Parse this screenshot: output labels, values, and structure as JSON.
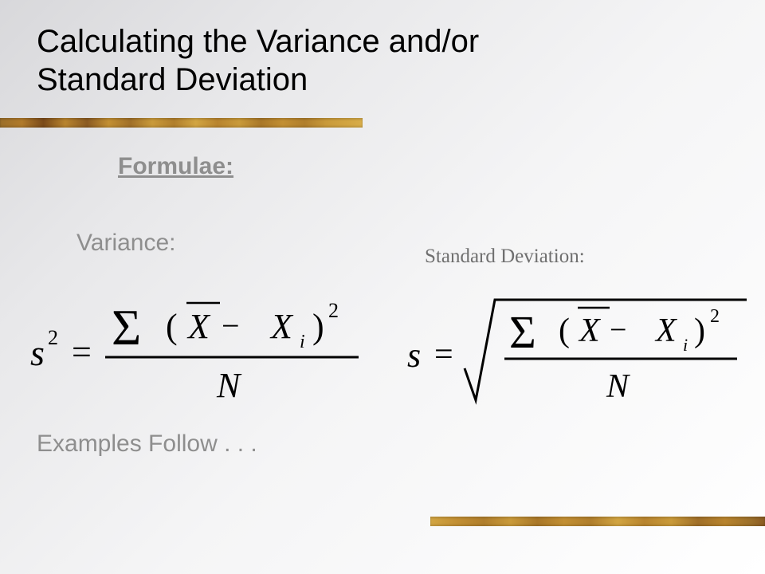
{
  "title_line1": "Calculating the Variance and/or",
  "title_line2": "Standard Deviation",
  "formulae_heading": "Formulae:",
  "variance_label": "Variance:",
  "stddev_label": "Standard Deviation:",
  "examples_label": "Examples Follow . . .",
  "formulas": {
    "variance": {
      "lhs_base": "s",
      "lhs_exp": "2",
      "numerator_sigma": "Σ",
      "numerator_term_prefix": "(",
      "numerator_xbar": "X",
      "numerator_minus": " − ",
      "numerator_xi_base": "X",
      "numerator_xi_sub": "i",
      "numerator_term_suffix": ")",
      "numerator_exp": "2",
      "denominator": "N"
    },
    "stddev": {
      "lhs_base": "s",
      "numerator_sigma": "Σ",
      "numerator_term_prefix": "(",
      "numerator_xbar": "X",
      "numerator_minus": " − ",
      "numerator_xi_base": "X",
      "numerator_xi_sub": "i",
      "numerator_term_suffix": ")",
      "numerator_exp": "2",
      "denominator": "N"
    }
  }
}
